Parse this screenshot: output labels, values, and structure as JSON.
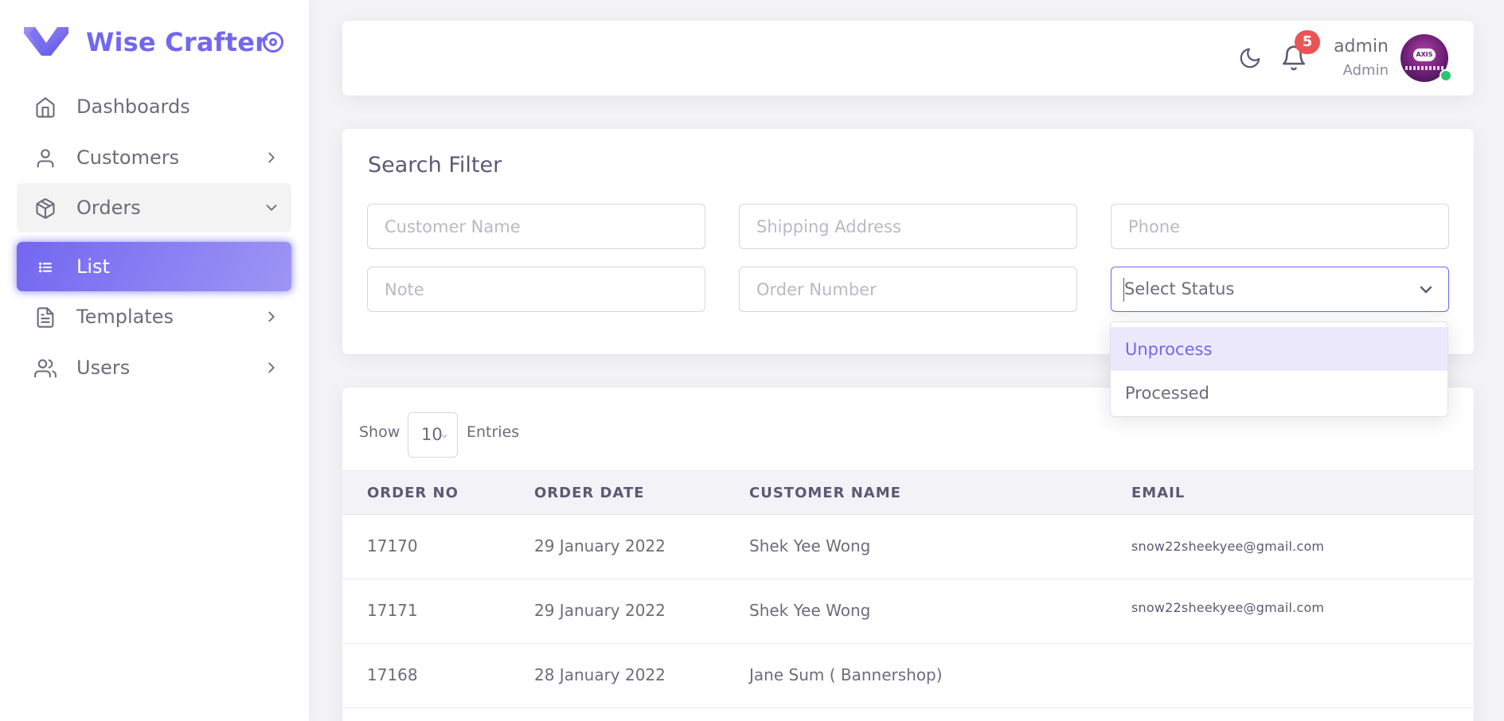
{
  "app": {
    "name": "Wise Crafter",
    "accent": "#7367f0"
  },
  "sidebar": {
    "items": [
      {
        "label": "Dashboards",
        "icon": "home-icon"
      },
      {
        "label": "Customers",
        "icon": "user-icon"
      },
      {
        "label": "Orders",
        "icon": "package-icon"
      },
      {
        "label": "List",
        "icon": "list-icon"
      },
      {
        "label": "Templates",
        "icon": "file-text-icon"
      },
      {
        "label": "Users",
        "icon": "users-icon"
      }
    ]
  },
  "navbar": {
    "notification_count": "5",
    "user_name": "admin",
    "user_role": "Admin",
    "avatar_text": "AXIS"
  },
  "filter": {
    "title": "Search Filter",
    "customer_name_placeholder": "Customer Name",
    "shipping_address_placeholder": "Shipping Address",
    "phone_placeholder": "Phone",
    "note_placeholder": "Note",
    "order_number_placeholder": "Order Number",
    "status_placeholder": "Select Status",
    "status_options": [
      "Unprocess",
      "Processed"
    ],
    "highlighted_option": "Unprocess"
  },
  "table": {
    "show_label": "Show",
    "entries_value": "10",
    "entries_label": "Entries",
    "columns": [
      "ORDER NO",
      "ORDER DATE",
      "CUSTOMER NAME",
      "EMAIL"
    ],
    "rows": [
      {
        "order_no": "17170",
        "order_date": "29 January 2022",
        "customer_name": "Shek Yee Wong",
        "email": "snow22sheekyee@gmail.com"
      },
      {
        "order_no": "17171",
        "order_date": "29 January 2022",
        "customer_name": "Shek Yee Wong",
        "email": "snow22sheekyee@gmail.com"
      },
      {
        "order_no": "17168",
        "order_date": "28 January 2022",
        "customer_name": "Jane Sum ( Bannershop)",
        "email": ""
      }
    ]
  }
}
